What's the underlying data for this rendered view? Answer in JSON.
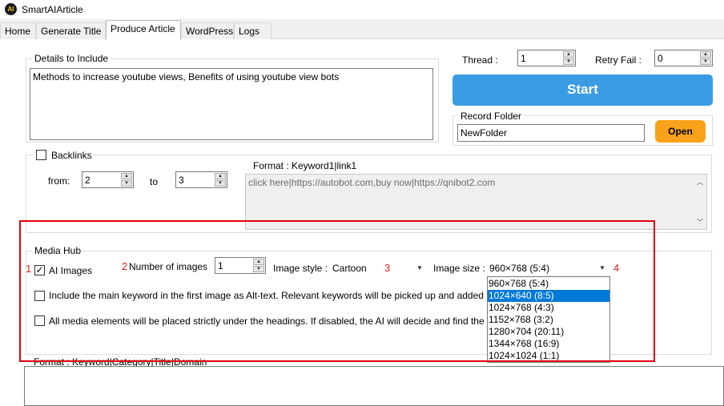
{
  "app": {
    "title": "SmartAIArticle",
    "icon_text": "AI"
  },
  "tabs": [
    {
      "label": "Home"
    },
    {
      "label": "Generate Title"
    },
    {
      "label": "Produce Article"
    },
    {
      "label": "WordPress"
    },
    {
      "label": "Logs"
    }
  ],
  "details": {
    "legend": "Details to Include",
    "value": "Methods to increase youtube views, Benefits of using youtube view bots"
  },
  "thread": {
    "label": "Thread :",
    "value": "1"
  },
  "retry": {
    "label": "Retry Fail :",
    "value": "0"
  },
  "start_label": "Start",
  "record_folder": {
    "legend": "Record Folder",
    "value": "NewFolder",
    "open_label": "Open"
  },
  "backlinks": {
    "label": "Backlinks",
    "from_label": "from:",
    "from_value": "2",
    "to_label": "to",
    "to_value": "3",
    "format_label": "Format : Keyword1|link1",
    "placeholder": "click here|https://autobot.com,buy now|https://qnibot2.com"
  },
  "media_hub": {
    "legend": "Media Hub",
    "ai_images_label": "AI Images",
    "ai_images_checked": true,
    "num_images_label": "Number of images",
    "num_images_value": "1",
    "image_style_label": "Image style :",
    "image_style_value": "Cartoon",
    "image_size_label": "Image size :",
    "image_size_value": "960×768 (5:4)",
    "alt_text_option": "Include the main keyword in the first image as Alt-text. Relevant keywords will be picked up and added t",
    "placement_option": "All media elements will be placed strictly under the headings. If disabled, the AI will decide and find the b",
    "size_options": [
      "960×768 (5:4)",
      "1024×640 (8:5)",
      "1024×768 (4:3)",
      "1152×768 (3:2)",
      "1280×704 (20:11)",
      "1344×768 (16:9)",
      "1024×1024 (1:1)"
    ],
    "selected_index": 1
  },
  "annotations": [
    "1",
    "2",
    "3",
    "4"
  ],
  "bottom_format_label": "Format : Keyword|Category|Title|Domain",
  "colors": {
    "accent": "#3a9de3",
    "open_button": "#f8a21a",
    "highlight_box": "#e3000f",
    "selection": "#0078d7"
  }
}
